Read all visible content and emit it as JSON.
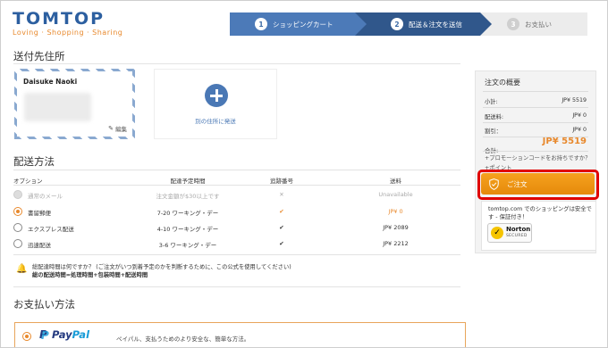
{
  "brand": {
    "name": "TOMTOP",
    "tagline": "Loving · Shopping · Sharing"
  },
  "steps": [
    {
      "num": "1",
      "label": "ショッピングカート"
    },
    {
      "num": "2",
      "label": "配送＆注文を送信"
    },
    {
      "num": "3",
      "label": "お支払い"
    }
  ],
  "address_section": {
    "title": "送付先住所",
    "card": {
      "name": "Daisuke  Naoki",
      "edit_label": "編集"
    },
    "add_label": "別の住所に発送"
  },
  "shipping_section": {
    "title": "配送方法",
    "headers": {
      "option": "オプション",
      "time": "配達予定時間",
      "tracking": "追跡番号",
      "cost": "送料"
    },
    "rows": [
      {
        "name": "通常のメール",
        "time": "注文金額が$30以上です",
        "tracking": "✕",
        "cost": "Unavailable",
        "state": "disabled"
      },
      {
        "name": "書留郵便",
        "time": "7-20 ワーキング・デー",
        "tracking": "✔",
        "cost": "JP¥ 0",
        "state": "selected"
      },
      {
        "name": "エクスプレス配送",
        "time": "4-10 ワーキング・デー",
        "tracking": "✔",
        "cost": "JP¥ 2089",
        "state": "normal"
      },
      {
        "name": "迅速配送",
        "time": "3-6 ワーキング・デー",
        "tracking": "✔",
        "cost": "JP¥ 2212",
        "state": "normal"
      }
    ],
    "note_line1": "総配達時間は何ですか？ (ご注文がいつ到着予定のかを判断するために、この公式を使用してください)",
    "note_line2": "総の配送時間=処理時間+包装時間+配送時間"
  },
  "payment_section": {
    "title": "お支払い方法",
    "paypal_pay": "Pay",
    "paypal_pal": "Pal",
    "paypal_desc": "ペイパル、支払うためのより安全な、簡単な方法。"
  },
  "summary": {
    "title": "注文の概要",
    "rows": [
      {
        "label": "小計:",
        "value": "JP¥ 5519"
      },
      {
        "label": "配送料:",
        "value": "JP¥ 0"
      },
      {
        "label": "割引：",
        "value": "JP¥  0"
      }
    ],
    "total_label": "合計:",
    "total_value": "JP¥  5519",
    "promo_link": "+プロモーションコードをお持ちですか？",
    "points_link": "+ポイント",
    "order_button": "ご注文",
    "secure_text": "tomtop.com でのショッピングは安全です - 保証付き！",
    "norton_name": "Norton",
    "norton_sub": "SECURED"
  },
  "colors": {
    "brand_blue": "#2c5fa0",
    "accent_orange": "#e8892d",
    "highlight_red": "#e00000",
    "paypal_dark": "#253b80",
    "paypal_light": "#179bd7"
  }
}
